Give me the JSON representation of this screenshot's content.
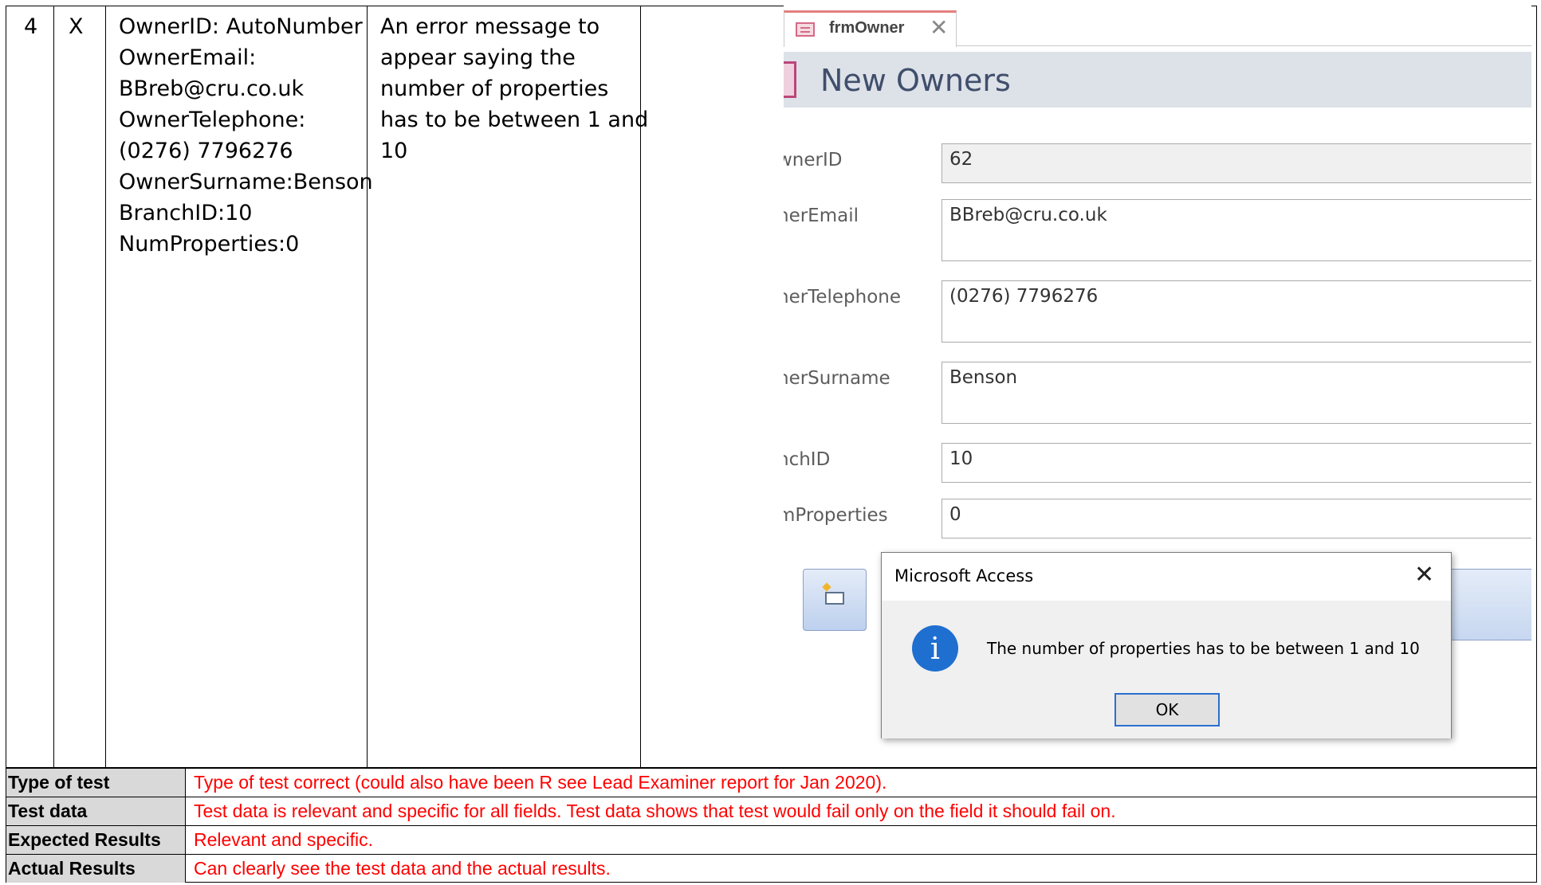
{
  "test_row": {
    "number": "4",
    "type": "X",
    "test_data_lines": [
      "OwnerID: AutoNumber",
      "OwnerEmail:",
      "BBreb@cru.co.uk",
      "OwnerTelephone:",
      "(0276) 7796276",
      "OwnerSurname:Benson",
      "BranchID:10",
      "NumProperties:0"
    ],
    "expected_lines": [
      "An error message to",
      "appear saying the",
      "number of properties",
      "has to be between 1 and",
      "10"
    ]
  },
  "access": {
    "tab_title": "frmOwner",
    "tab_close": "✕",
    "form_title": "New Owners",
    "fields": [
      {
        "label": "wnerID",
        "value": "62"
      },
      {
        "label": "nerEmail",
        "value": "BBreb@cru.co.uk"
      },
      {
        "label": "nerTelephone",
        "value": "(0276) 7796276"
      },
      {
        "label": "nerSurname",
        "value": "Benson"
      },
      {
        "label": "nchID",
        "value": "10"
      },
      {
        "label": "mProperties",
        "value": "0"
      }
    ],
    "dialog": {
      "title": "Microsoft Access",
      "close": "✕",
      "icon": "i",
      "message": "The number of properties has to be between 1 and 10",
      "ok_label": "OK"
    }
  },
  "feedback": [
    {
      "label": "Type of test",
      "value": "Type of test correct (could also have been R see Lead Examiner report for Jan 2020)."
    },
    {
      "label": "Test data",
      "value": "Test data is relevant and specific for all fields. Test data shows that test would fail only on the field it should fail on."
    },
    {
      "label": "Expected Results",
      "value": "Relevant and specific."
    },
    {
      "label": "Actual Results",
      "value": "Can clearly see the test data and the actual results."
    }
  ],
  "colors": {
    "feedback_text": "#ff0000",
    "label_bg": "#d9d9d9",
    "form_header_bg": "#dde1e8",
    "info_icon": "#1f6fd0"
  }
}
